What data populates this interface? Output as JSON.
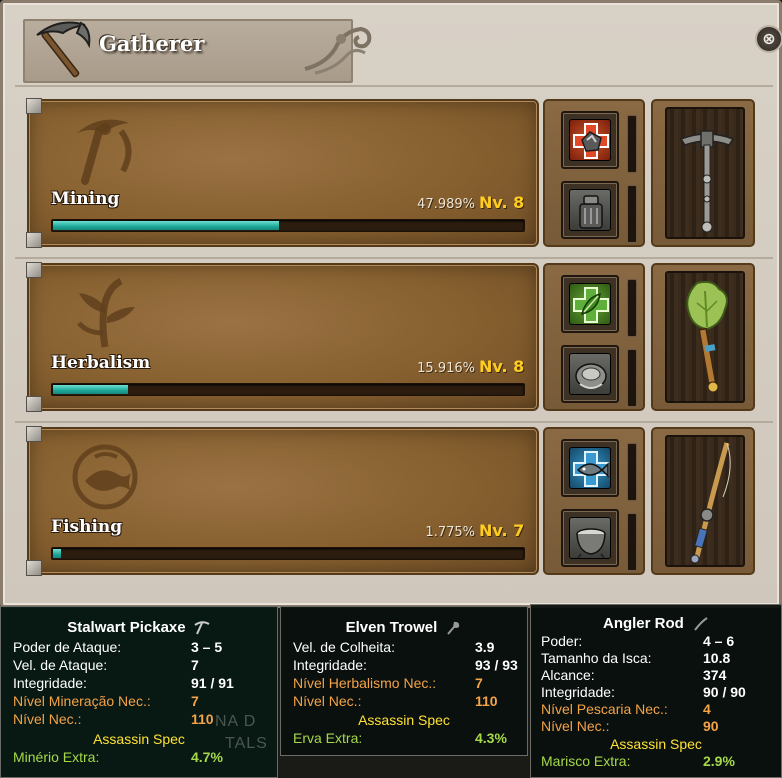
{
  "window": {
    "title": "Gatherer",
    "close_label": "⊗"
  },
  "skills": [
    {
      "name": "Mining",
      "percent": "47.989%",
      "level": "Nv. 8",
      "progress": 0.47989,
      "emblem_icon": "pickaxe-emblem-icon",
      "slot_top_icon": "mining-boost-icon",
      "slot_bottom_icon": "ore-bag-icon",
      "tool_icon": "pickaxe-tool-icon"
    },
    {
      "name": "Herbalism",
      "percent": "15.916%",
      "level": "Nv. 8",
      "progress": 0.15916,
      "emblem_icon": "herb-emblem-icon",
      "slot_top_icon": "herbalism-boost-icon",
      "slot_bottom_icon": "herb-bag-icon",
      "tool_icon": "trowel-tool-icon"
    },
    {
      "name": "Fishing",
      "percent": "1.775%",
      "level": "Nv. 7",
      "progress": 0.01775,
      "emblem_icon": "fish-emblem-icon",
      "slot_top_icon": "fishing-boost-icon",
      "slot_bottom_icon": "bait-pot-icon",
      "tool_icon": "fishing-rod-tool-icon"
    }
  ],
  "tooltips": {
    "pickaxe": {
      "title": "Stalwart Pickaxe",
      "rows": [
        {
          "label": "Poder de Ataque:",
          "value": "3 – 5"
        },
        {
          "label": "Vel. de Ataque:",
          "value": "7"
        },
        {
          "label": "Integridade:",
          "value": "91 / 91"
        },
        {
          "label": "Nível Mineração Nec.:",
          "value": "7"
        },
        {
          "label": "Nível Nec.:",
          "value": "110"
        }
      ],
      "spec": "Assassin Spec",
      "extra_label": "Minério Extra:",
      "extra_value": "4.7%",
      "background_text_1": "NA D",
      "background_text_2": "TALS"
    },
    "trowel": {
      "title": "Elven Trowel",
      "rows": [
        {
          "label": "Vel. de Colheita:",
          "value": "3.9"
        },
        {
          "label": "Integridade:",
          "value": "93 / 93"
        },
        {
          "label": "Nível Herbalismo Nec.:",
          "value": "7"
        },
        {
          "label": "Nível Nec.:",
          "value": "110"
        }
      ],
      "spec": "Assassin Spec",
      "extra_label": "Erva Extra:",
      "extra_value": "4.3%"
    },
    "rod": {
      "title": "Angler Rod",
      "rows": [
        {
          "label": "Poder:",
          "value": "4 – 6"
        },
        {
          "label": "Tamanho da Isca:",
          "value": "10.8"
        },
        {
          "label": "Alcance:",
          "value": "374"
        },
        {
          "label": "Integridade:",
          "value": "90 / 90"
        },
        {
          "label": "Nível Pescaria Nec.:",
          "value": "4"
        },
        {
          "label": "Nível Nec.:",
          "value": "90"
        }
      ],
      "spec": "Assassin Spec",
      "extra_label": "Marisco Extra:",
      "extra_value": "2.9%"
    }
  },
  "colors": {
    "progress_fill": "#1da89a",
    "level_text": "#ffcc22",
    "requirement_text": "#f4a347",
    "extra_text": "#a6d94a",
    "spec_text": "#ffe135"
  }
}
